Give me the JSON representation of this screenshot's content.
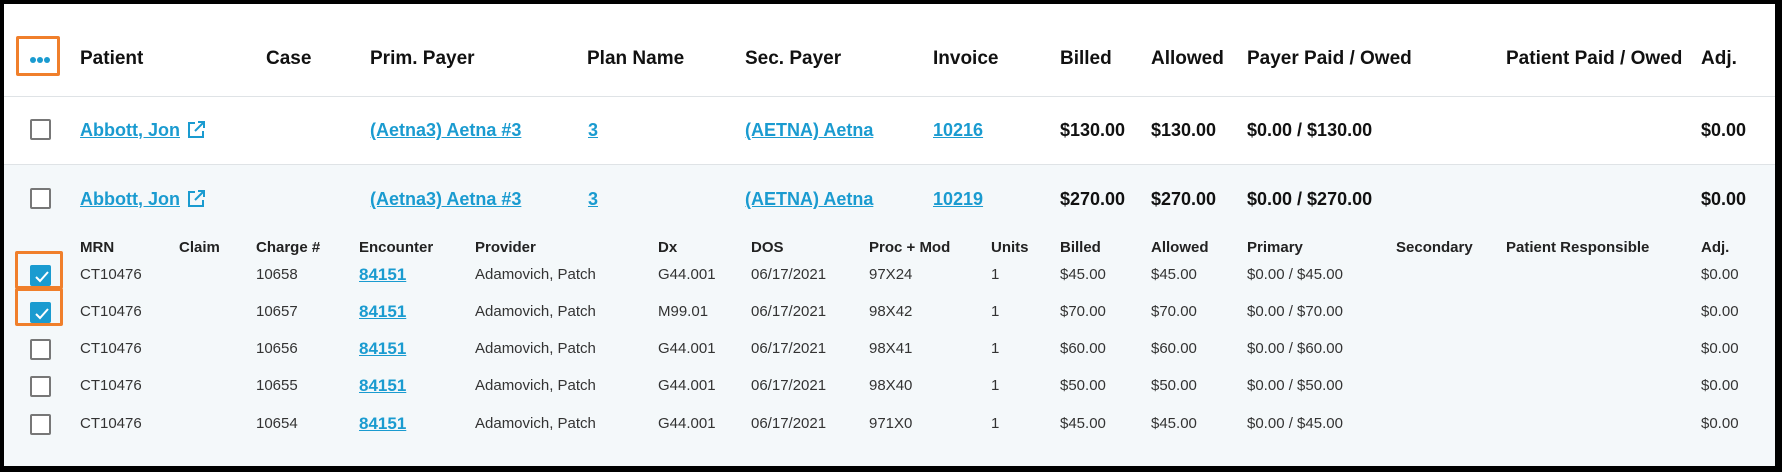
{
  "header": {
    "menu_icon": "more-horizontal-icon",
    "columns": [
      "Patient",
      "Case",
      "Prim. Payer",
      "Plan Name",
      "Sec. Payer",
      "Invoice",
      "Billed",
      "Allowed",
      "Payer Paid / Owed",
      "Patient Paid / Owed",
      "Adj."
    ]
  },
  "rows": [
    {
      "patient": "Abbott, Jon",
      "prim_payer": "(Aetna3) Aetna #3",
      "plan": "3",
      "sec_payer": "(AETNA) Aetna",
      "invoice": "10216",
      "billed": "$130.00",
      "allowed": "$130.00",
      "payer_paid": "$0.00 / $130.00",
      "adj": "$0.00"
    },
    {
      "patient": "Abbott, Jon",
      "prim_payer": "(Aetna3) Aetna #3",
      "plan": "3",
      "sec_payer": "(AETNA) Aetna",
      "invoice": "10219",
      "billed": "$270.00",
      "allowed": "$270.00",
      "payer_paid": "$0.00 / $270.00",
      "adj": "$0.00"
    }
  ],
  "detail": {
    "columns": [
      "MRN",
      "Claim",
      "Charge #",
      "Encounter",
      "Provider",
      "Dx",
      "DOS",
      "Proc + Mod",
      "Units",
      "Billed",
      "Allowed",
      "Primary",
      "Secondary",
      "Patient Responsible",
      "Adj."
    ],
    "rows": [
      {
        "checked": true,
        "mrn": "CT10476",
        "charge": "10658",
        "encounter": "84151",
        "provider": "Adamovich, Patch",
        "dx": "G44.001",
        "dos": "06/17/2021",
        "proc": "97X24",
        "units": "1",
        "billed": "$45.00",
        "allowed": "$45.00",
        "primary": "$0.00 / $45.00",
        "adj": "$0.00"
      },
      {
        "checked": true,
        "mrn": "CT10476",
        "charge": "10657",
        "encounter": "84151",
        "provider": "Adamovich, Patch",
        "dx": "M99.01",
        "dos": "06/17/2021",
        "proc": "98X42",
        "units": "1",
        "billed": "$70.00",
        "allowed": "$70.00",
        "primary": "$0.00 / $70.00",
        "adj": "$0.00"
      },
      {
        "checked": false,
        "mrn": "CT10476",
        "charge": "10656",
        "encounter": "84151",
        "provider": "Adamovich, Patch",
        "dx": "G44.001",
        "dos": "06/17/2021",
        "proc": "98X41",
        "units": "1",
        "billed": "$60.00",
        "allowed": "$60.00",
        "primary": "$0.00 / $60.00",
        "adj": "$0.00"
      },
      {
        "checked": false,
        "mrn": "CT10476",
        "charge": "10655",
        "encounter": "84151",
        "provider": "Adamovich, Patch",
        "dx": "G44.001",
        "dos": "06/17/2021",
        "proc": "98X40",
        "units": "1",
        "billed": "$50.00",
        "allowed": "$50.00",
        "primary": "$0.00 / $50.00",
        "adj": "$0.00"
      },
      {
        "checked": false,
        "mrn": "CT10476",
        "charge": "10654",
        "encounter": "84151",
        "provider": "Adamovich, Patch",
        "dx": "G44.001",
        "dos": "06/17/2021",
        "proc": "971X0",
        "units": "1",
        "billed": "$45.00",
        "allowed": "$45.00",
        "primary": "$0.00 / $45.00",
        "adj": "$0.00"
      }
    ]
  },
  "colors": {
    "accent": "#1a9bd0",
    "highlight": "#f07f2b",
    "expanded_bg": "#f4f8fa"
  }
}
